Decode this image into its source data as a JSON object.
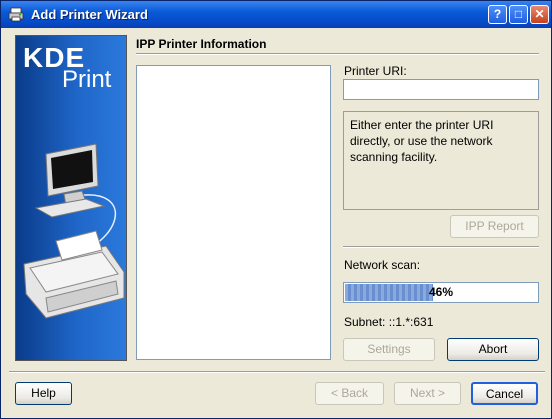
{
  "window": {
    "title": "Add Printer Wizard"
  },
  "titlebar_buttons": {
    "help": "?",
    "maximize": "□",
    "close": "✕"
  },
  "side": {
    "brand": "KDE",
    "product": "Print"
  },
  "page": {
    "heading": "IPP Printer Information"
  },
  "uri": {
    "label": "Printer URI:",
    "value": ""
  },
  "help_text": "Either enter the printer URI directly, or use the network scanning facility.",
  "buttons": {
    "ipp_report": "IPP Report",
    "settings": "Settings",
    "abort": "Abort",
    "help": "Help",
    "back": "< Back",
    "next": "Next >",
    "cancel": "Cancel"
  },
  "scan": {
    "label": "Network scan:",
    "progress_text": "46%",
    "progress": 0.46,
    "subnet": "Subnet: ::1.*:631"
  },
  "colors": {
    "titlebar": "#0648c4",
    "face": "#ece9d8",
    "progress_fill": "#6a8fd0"
  }
}
